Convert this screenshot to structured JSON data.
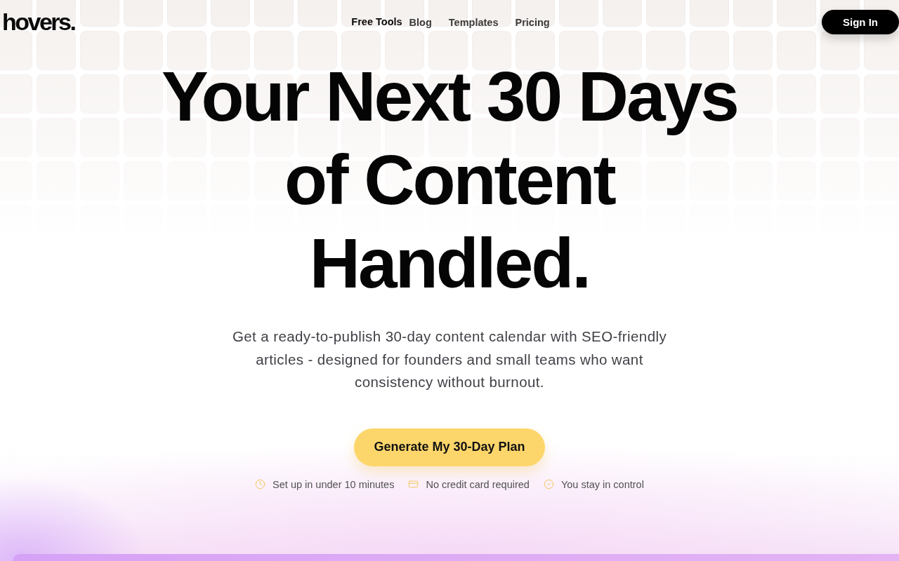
{
  "header": {
    "logo": "hovers.",
    "nav": [
      {
        "label": "Free Tools",
        "selected": true
      },
      {
        "label": "Blog",
        "selected": false
      },
      {
        "label": "Templates",
        "selected": false
      },
      {
        "label": "Pricing",
        "selected": false
      }
    ],
    "sign_in_button": {
      "label": "Sign In"
    }
  },
  "hero": {
    "headline": "Your Next 30 Days of Content Handled.",
    "subtitle": "Get a ready-to-publish 30-day content calendar with SEO-friendly articles - designed for founders and small teams who want consistency without burnout.",
    "cta_button": {
      "label": "Generate My 30-Day Plan"
    },
    "features": [
      {
        "kind": "time",
        "label": "Set up in under 10 minutes"
      },
      {
        "kind": "payment",
        "label": "No credit card required"
      },
      {
        "kind": "control",
        "label": "You stay in control"
      }
    ]
  }
}
